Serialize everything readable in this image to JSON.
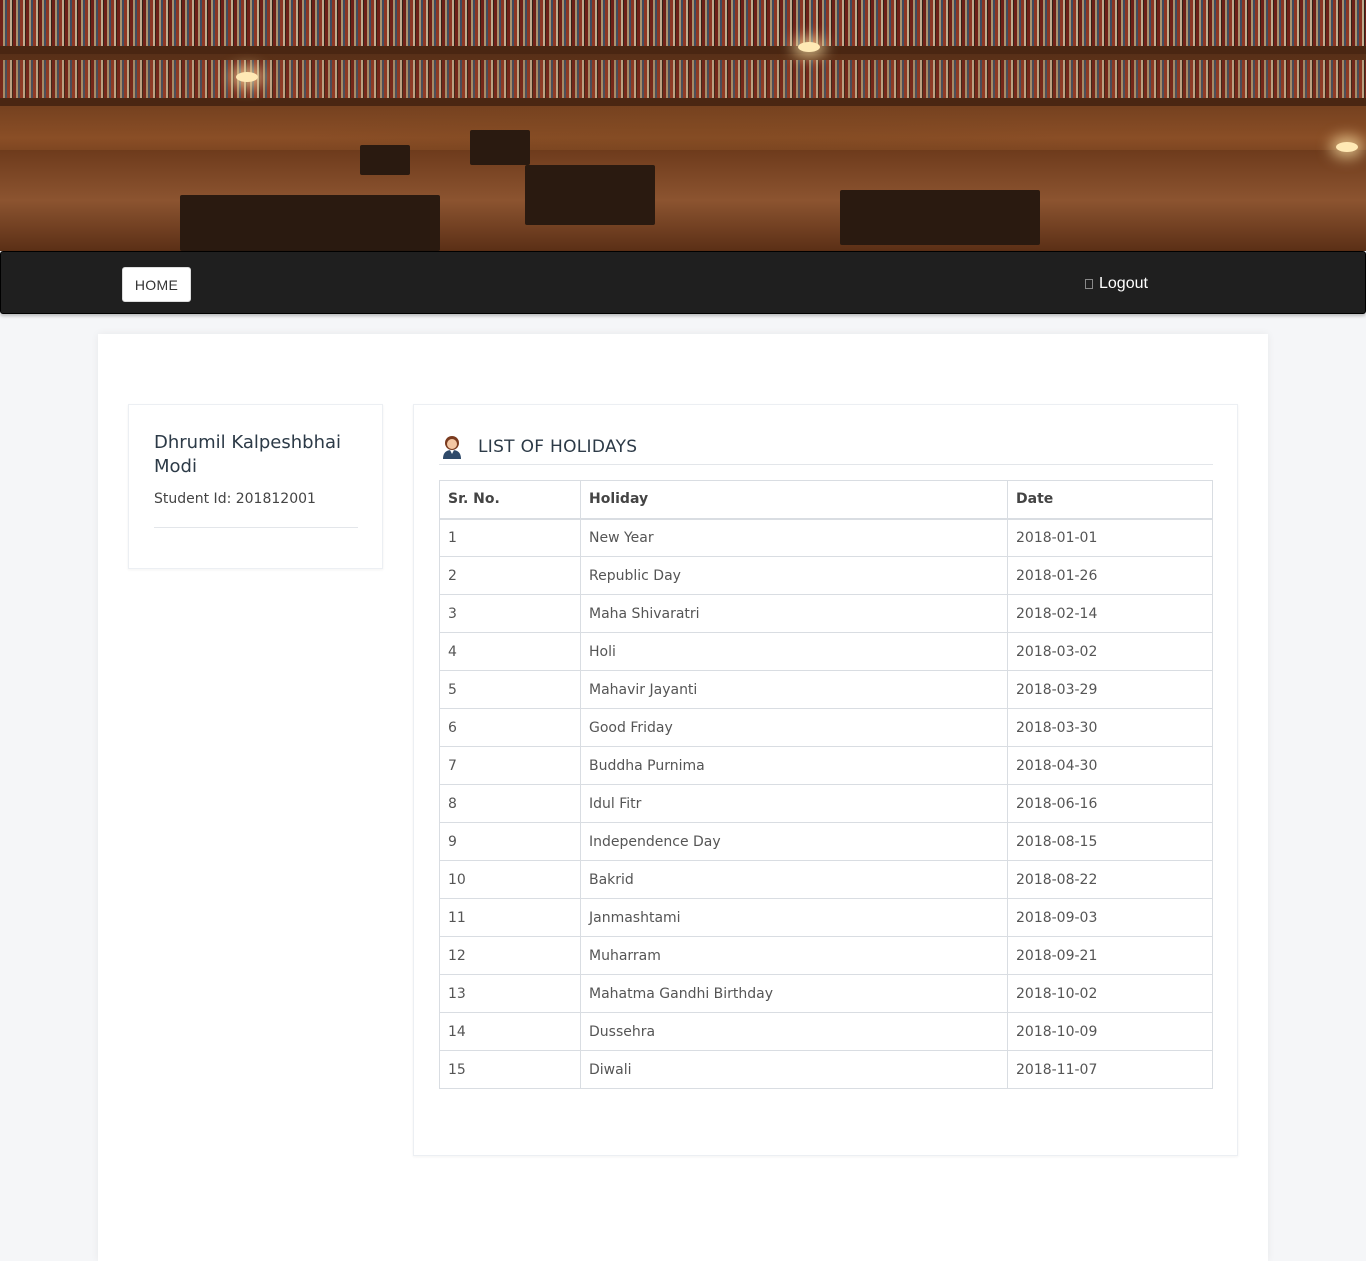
{
  "nav": {
    "home_label": "HOME",
    "logout_label": "Logout"
  },
  "profile": {
    "name": "Dhrumil Kalpeshbhai Modi",
    "student_id": "Student Id: 201812001"
  },
  "holidays": {
    "title": "LIST OF HOLIDAYS",
    "columns": [
      "Sr. No.",
      "Holiday",
      "Date"
    ],
    "rows": [
      [
        "1",
        "New Year",
        "2018-01-01"
      ],
      [
        "2",
        "Republic Day",
        "2018-01-26"
      ],
      [
        "3",
        "Maha Shivaratri",
        "2018-02-14"
      ],
      [
        "4",
        "Holi",
        "2018-03-02"
      ],
      [
        "5",
        "Mahavir Jayanti",
        "2018-03-29"
      ],
      [
        "6",
        "Good Friday",
        "2018-03-30"
      ],
      [
        "7",
        "Buddha Purnima",
        "2018-04-30"
      ],
      [
        "8",
        "Idul Fitr",
        "2018-06-16"
      ],
      [
        "9",
        "Independence Day",
        "2018-08-15"
      ],
      [
        "10",
        "Bakrid",
        "2018-08-22"
      ],
      [
        "11",
        "Janmashtami",
        "2018-09-03"
      ],
      [
        "12",
        "Muharram",
        "2018-09-21"
      ],
      [
        "13",
        "Mahatma Gandhi Birthday",
        "2018-10-02"
      ],
      [
        "14",
        "Dussehra",
        "2018-10-09"
      ],
      [
        "15",
        "Diwali",
        "2018-11-07"
      ]
    ]
  },
  "colors": {
    "navbar": "#1f1f1f",
    "page_bg": "#f5f6f8",
    "border": "#d9dde2"
  }
}
